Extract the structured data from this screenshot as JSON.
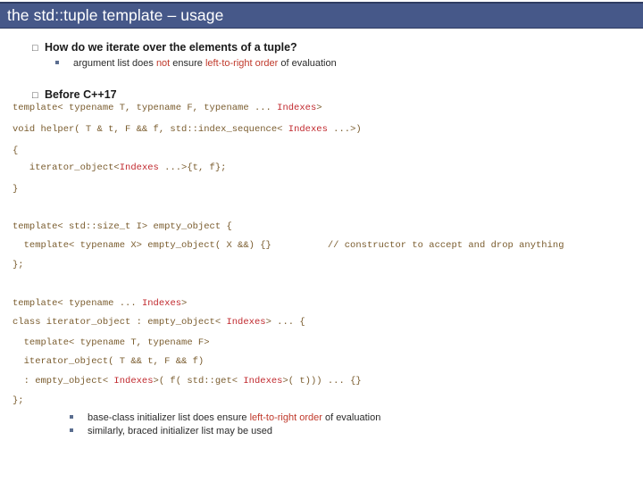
{
  "slide": {
    "title": "the std::tuple template – usage",
    "title_bg": "#465889",
    "title_color": "#ffffff",
    "background": "#ffffff"
  },
  "bullets": {
    "level1_marker": "□",
    "items": [
      {
        "label": "How do we iterate over the elements of a tuple?"
      },
      {
        "label": "Before C++17"
      }
    ],
    "sub_top": {
      "prefix": "argument list does ",
      "red1": "not",
      "mid": " ensure ",
      "red2": "left-to-right order",
      "suffix": " of evaluation"
    },
    "sub_bottom": [
      {
        "prefix": "base-class initializer list does ensure ",
        "red": "left-to-right order",
        "suffix": " of evaluation"
      },
      {
        "prefix": "similarly, braced initializer list may be used",
        "red": "",
        "suffix": ""
      }
    ]
  },
  "code": {
    "accent_color": "#7a5c2e",
    "highlight_color": "#c0282d",
    "block1": [
      {
        "pre": "template< typename T, typename F, typename ... ",
        "idx": "Indexes",
        "post": ">"
      },
      {
        "pre": "void helper( T & t, F && f, std::index_sequence< ",
        "idx": "Indexes",
        "post": " ...>)"
      },
      {
        "pre": "{",
        "idx": "",
        "post": ""
      },
      {
        "pre": "   iterator_object<",
        "idx": "Indexes",
        "post": " ...>{t, f};"
      },
      {
        "pre": "}",
        "idx": "",
        "post": ""
      }
    ],
    "block2": [
      {
        "pre": "template< std::size_t I> empty_object {",
        "idx": "",
        "post": ""
      },
      {
        "pre": "  template< typename X> empty_object( X &&) {}          // constructor to accept and drop anything",
        "idx": "",
        "post": ""
      },
      {
        "pre": "};",
        "idx": "",
        "post": ""
      }
    ],
    "block3": [
      {
        "pre": "template< typename ... ",
        "idx": "Indexes",
        "post": ">"
      },
      {
        "pre": "class iterator_object : empty_object< ",
        "idx": "Indexes",
        "post": "> ... {"
      },
      {
        "pre": "  template< typename T, typename F>",
        "idx": "",
        "post": ""
      },
      {
        "pre": "  iterator_object( T && t, F && f)",
        "idx": "",
        "post": ""
      },
      {
        "pre": "  : empty_object< ",
        "idx": "Indexes",
        "post": ">( f( std::get< @@Indexes@@>( t))) ... {}"
      },
      {
        "pre": "};",
        "idx": "",
        "post": ""
      }
    ]
  }
}
